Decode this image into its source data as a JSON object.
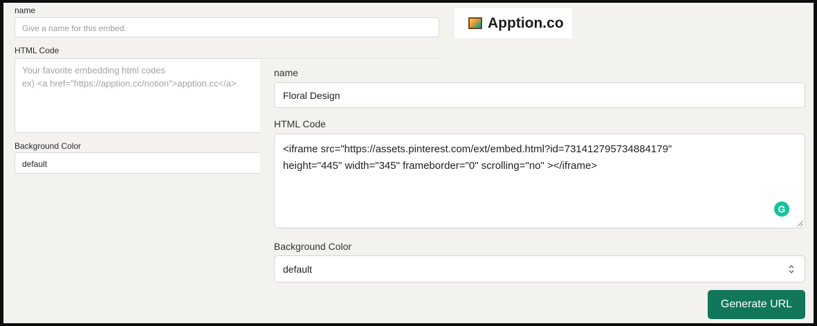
{
  "background_form": {
    "name_label": "name",
    "name_placeholder": "Give a name for this embed.",
    "html_label": "HTML Code",
    "html_placeholder_line1": "Your favorite embedding html codes",
    "html_placeholder_line2": "ex) <a href=\"https://apption.cc/notion\">apption.cc</a>",
    "bg_label": "Background Color",
    "bg_value": "default"
  },
  "logo": {
    "text": "Apption.co",
    "icon": "picture-icon"
  },
  "form": {
    "name_label": "name",
    "name_value": "Floral Design",
    "html_label": "HTML Code",
    "html_line1": "<iframe src=\"https://assets.pinterest.com/ext/embed.html?id=731412795734884179\"",
    "html_line2": "height=\"445\" width=\"345\" frameborder=\"0\" scrolling=\"no\" ></iframe>",
    "grammarly_letter": "G",
    "bg_label": "Background Color",
    "bg_value": "default",
    "select_icon": "chevron-up-down-icon",
    "submit_label": "Generate URL"
  },
  "colors": {
    "accent": "#12775a",
    "grammarly": "#15c39a",
    "page_bg": "#f3f2ef"
  }
}
